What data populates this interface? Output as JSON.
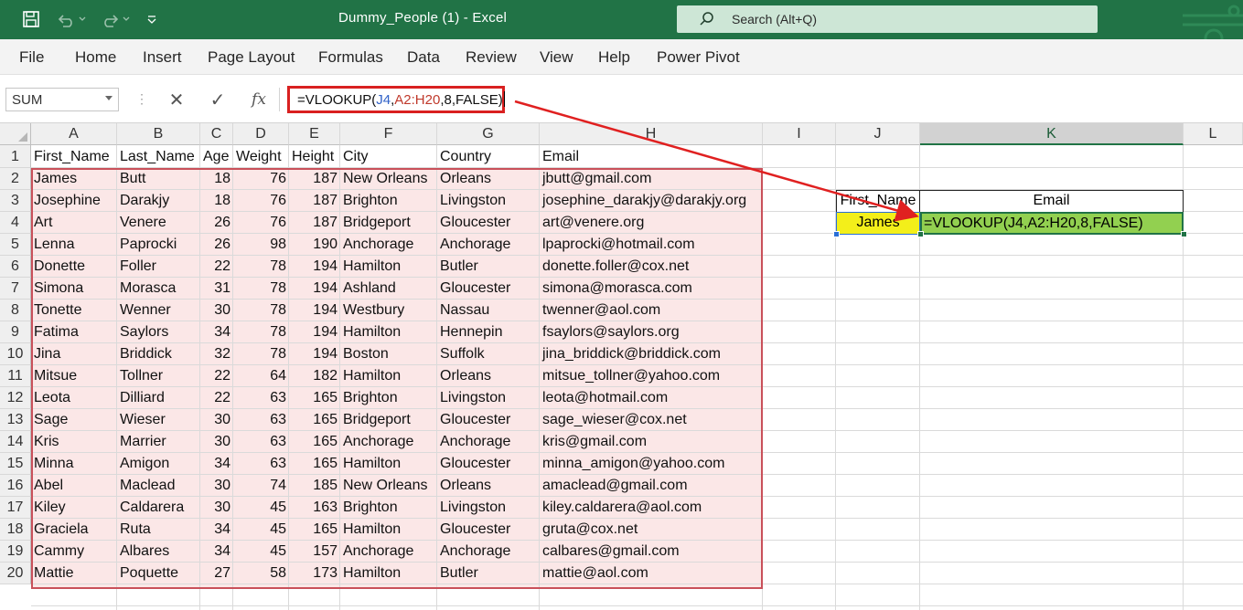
{
  "titlebar": {
    "title": "Dummy_People (1)  -  Excel",
    "search_placeholder": "Search (Alt+Q)"
  },
  "menu": [
    "File",
    "Home",
    "Insert",
    "Page Layout",
    "Formulas",
    "Data",
    "Review",
    "View",
    "Help",
    "Power Pivot"
  ],
  "formula_bar": {
    "name_box": "SUM",
    "cancel_symbol": "✕",
    "enter_symbol": "✓",
    "fx_label": "fx",
    "formula_parts": {
      "prefix": "=VLOOKUP(",
      "ref1": "J4",
      "sep1": ",",
      "ref2": "A2:H20",
      "suffix": ",8,FALSE)"
    }
  },
  "columns": [
    "A",
    "B",
    "C",
    "D",
    "E",
    "F",
    "G",
    "H",
    "I",
    "J",
    "K",
    "L"
  ],
  "selected_column": "K",
  "rows": [
    "1",
    "2",
    "3",
    "4",
    "5",
    "6",
    "7",
    "8",
    "9",
    "10",
    "11",
    "12",
    "13",
    "14",
    "15",
    "16",
    "17",
    "18",
    "19",
    "20"
  ],
  "headers": [
    "First_Name",
    "Last_Name",
    "Age",
    "Weight",
    "Height",
    "City",
    "Country",
    "Email"
  ],
  "table": [
    [
      "James",
      "Butt",
      "18",
      "76",
      "187",
      "New Orleans",
      "Orleans",
      "jbutt@gmail.com"
    ],
    [
      "Josephine",
      "Darakjy",
      "18",
      "76",
      "187",
      "Brighton",
      "Livingston",
      "josephine_darakjy@darakjy.org"
    ],
    [
      "Art",
      "Venere",
      "26",
      "76",
      "187",
      "Bridgeport",
      "Gloucester",
      "art@venere.org"
    ],
    [
      "Lenna",
      "Paprocki",
      "26",
      "98",
      "190",
      "Anchorage",
      "Anchorage",
      "lpaprocki@hotmail.com"
    ],
    [
      "Donette",
      "Foller",
      "22",
      "78",
      "194",
      "Hamilton",
      "Butler",
      "donette.foller@cox.net"
    ],
    [
      "Simona",
      "Morasca",
      "31",
      "78",
      "194",
      "Ashland",
      "Gloucester",
      "simona@morasca.com"
    ],
    [
      "Tonette",
      "Wenner",
      "30",
      "78",
      "194",
      "Westbury",
      "Nassau",
      "twenner@aol.com"
    ],
    [
      "Fatima",
      "Saylors",
      "34",
      "78",
      "194",
      "Hamilton",
      "Hennepin",
      "fsaylors@saylors.org"
    ],
    [
      "Jina",
      "Briddick",
      "32",
      "78",
      "194",
      "Boston",
      "Suffolk",
      "jina_briddick@briddick.com"
    ],
    [
      "Mitsue",
      "Tollner",
      "22",
      "64",
      "182",
      "Hamilton",
      "Orleans",
      "mitsue_tollner@yahoo.com"
    ],
    [
      "Leota",
      "Dilliard",
      "22",
      "63",
      "165",
      "Brighton",
      "Livingston",
      "leota@hotmail.com"
    ],
    [
      "Sage",
      "Wieser",
      "30",
      "63",
      "165",
      "Bridgeport",
      "Gloucester",
      "sage_wieser@cox.net"
    ],
    [
      "Kris",
      "Marrier",
      "30",
      "63",
      "165",
      "Anchorage",
      "Anchorage",
      "kris@gmail.com"
    ],
    [
      "Minna",
      "Amigon",
      "34",
      "63",
      "165",
      "Hamilton",
      "Gloucester",
      "minna_amigon@yahoo.com"
    ],
    [
      "Abel",
      "Maclead",
      "30",
      "74",
      "185",
      "New Orleans",
      "Orleans",
      "amaclead@gmail.com"
    ],
    [
      "Kiley",
      "Caldarera",
      "30",
      "45",
      "163",
      "Brighton",
      "Livingston",
      "kiley.caldarera@aol.com"
    ],
    [
      "Graciela",
      "Ruta",
      "34",
      "45",
      "165",
      "Hamilton",
      "Gloucester",
      "gruta@cox.net"
    ],
    [
      "Cammy",
      "Albares",
      "34",
      "45",
      "157",
      "Anchorage",
      "Anchorage",
      "calbares@gmail.com"
    ],
    [
      "Mattie",
      "Poquette",
      "27",
      "58",
      "173",
      "Hamilton",
      "Butler",
      "mattie@aol.com"
    ]
  ],
  "lookup": {
    "header_j": "First_Name",
    "header_k": "Email",
    "value_j": "James",
    "value_k": "=VLOOKUP(J4,A2:H20,8,FALSE)"
  }
}
